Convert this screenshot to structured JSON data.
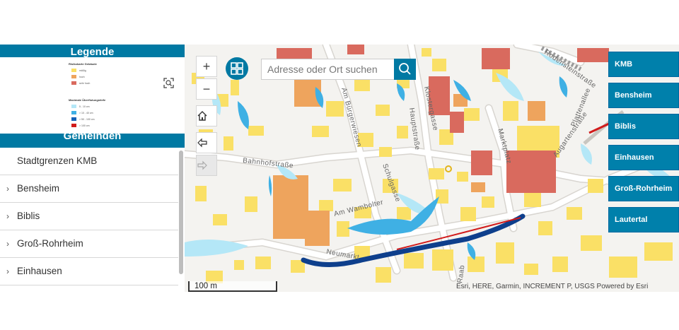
{
  "legend": {
    "header": "Legende",
    "risk_title": "Risikokarte Gebäude",
    "risk_items": [
      {
        "label": "mäßig",
        "color": "#fae066"
      },
      {
        "label": "hoch",
        "color": "#eea45d"
      },
      {
        "label": "sehr hoch",
        "color": "#d96a5e"
      }
    ],
    "depth_title": "Maximale Überflutungstiefe",
    "depth_items": [
      {
        "label": "5 - 10 cm",
        "color": "#b4e7f7"
      },
      {
        "label": "> 10 - 40 cm",
        "color": "#3fb0e4"
      },
      {
        "label": "> 50 - 100 cm",
        "color": "#1461b8"
      },
      {
        "label": "> 100 cm",
        "color": "#d11b1b"
      }
    ]
  },
  "layers": {
    "header": "Gemeinden",
    "items": [
      {
        "label": "Stadtgrenzen KMB",
        "expandable": false
      },
      {
        "label": "Bensheim",
        "expandable": true
      },
      {
        "label": "Biblis",
        "expandable": true
      },
      {
        "label": "Groß-Rohrheim",
        "expandable": true
      },
      {
        "label": "Einhausen",
        "expandable": true
      }
    ]
  },
  "search": {
    "placeholder": "Adresse oder Ort suchen"
  },
  "map_controls": {
    "zoom_in": "+",
    "zoom_out": "−"
  },
  "city_buttons": [
    "KMB",
    "Bensheim",
    "Biblis",
    "Einhausen",
    "Groß-Rohrheim",
    "Lautertal"
  ],
  "scalebar": "100 m",
  "attribution": "Esri, HERE, Garmin, INCREMENT P, USGS   Powered by Esri",
  "street_labels": [
    "Bahnhofstraße",
    "Am Bürgerwiesen",
    "Hauptstraße",
    "Klostergasse",
    "Schulgasse",
    "Am Wambolter",
    "Neumarkt",
    "Marktplatz",
    "Augartenstraße",
    "Plattenallee",
    "Raab",
    "Rodensteinstraße"
  ],
  "colors": {
    "accent": "#0079a3",
    "risk_medium": "#fae066",
    "risk_high": "#eea45d",
    "risk_very_high": "#d96a5e"
  }
}
